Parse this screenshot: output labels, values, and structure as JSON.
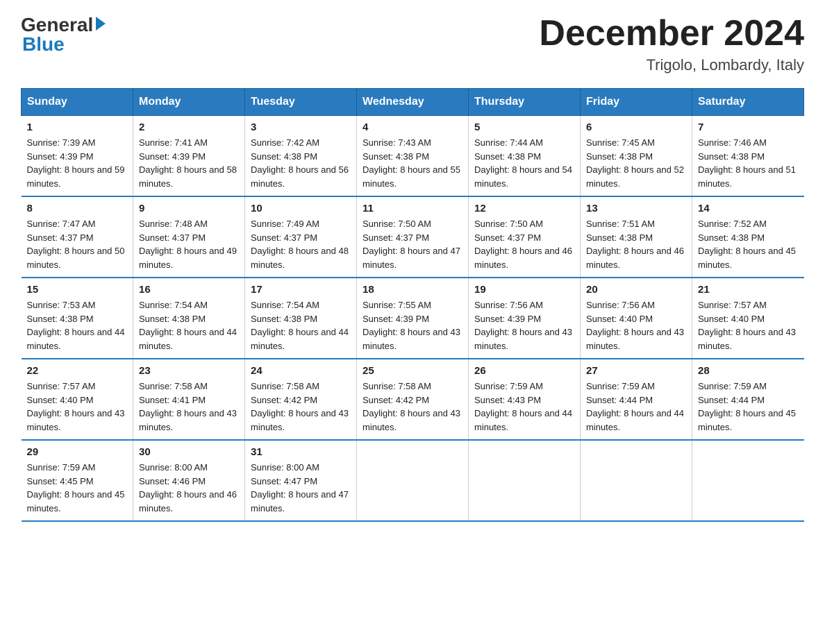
{
  "header": {
    "logo_general": "General",
    "logo_blue": "Blue",
    "month_title": "December 2024",
    "location": "Trigolo, Lombardy, Italy"
  },
  "days_of_week": [
    "Sunday",
    "Monday",
    "Tuesday",
    "Wednesday",
    "Thursday",
    "Friday",
    "Saturday"
  ],
  "weeks": [
    [
      {
        "day": "1",
        "sunrise": "7:39 AM",
        "sunset": "4:39 PM",
        "daylight": "8 hours and 59 minutes."
      },
      {
        "day": "2",
        "sunrise": "7:41 AM",
        "sunset": "4:39 PM",
        "daylight": "8 hours and 58 minutes."
      },
      {
        "day": "3",
        "sunrise": "7:42 AM",
        "sunset": "4:38 PM",
        "daylight": "8 hours and 56 minutes."
      },
      {
        "day": "4",
        "sunrise": "7:43 AM",
        "sunset": "4:38 PM",
        "daylight": "8 hours and 55 minutes."
      },
      {
        "day": "5",
        "sunrise": "7:44 AM",
        "sunset": "4:38 PM",
        "daylight": "8 hours and 54 minutes."
      },
      {
        "day": "6",
        "sunrise": "7:45 AM",
        "sunset": "4:38 PM",
        "daylight": "8 hours and 52 minutes."
      },
      {
        "day": "7",
        "sunrise": "7:46 AM",
        "sunset": "4:38 PM",
        "daylight": "8 hours and 51 minutes."
      }
    ],
    [
      {
        "day": "8",
        "sunrise": "7:47 AM",
        "sunset": "4:37 PM",
        "daylight": "8 hours and 50 minutes."
      },
      {
        "day": "9",
        "sunrise": "7:48 AM",
        "sunset": "4:37 PM",
        "daylight": "8 hours and 49 minutes."
      },
      {
        "day": "10",
        "sunrise": "7:49 AM",
        "sunset": "4:37 PM",
        "daylight": "8 hours and 48 minutes."
      },
      {
        "day": "11",
        "sunrise": "7:50 AM",
        "sunset": "4:37 PM",
        "daylight": "8 hours and 47 minutes."
      },
      {
        "day": "12",
        "sunrise": "7:50 AM",
        "sunset": "4:37 PM",
        "daylight": "8 hours and 46 minutes."
      },
      {
        "day": "13",
        "sunrise": "7:51 AM",
        "sunset": "4:38 PM",
        "daylight": "8 hours and 46 minutes."
      },
      {
        "day": "14",
        "sunrise": "7:52 AM",
        "sunset": "4:38 PM",
        "daylight": "8 hours and 45 minutes."
      }
    ],
    [
      {
        "day": "15",
        "sunrise": "7:53 AM",
        "sunset": "4:38 PM",
        "daylight": "8 hours and 44 minutes."
      },
      {
        "day": "16",
        "sunrise": "7:54 AM",
        "sunset": "4:38 PM",
        "daylight": "8 hours and 44 minutes."
      },
      {
        "day": "17",
        "sunrise": "7:54 AM",
        "sunset": "4:38 PM",
        "daylight": "8 hours and 44 minutes."
      },
      {
        "day": "18",
        "sunrise": "7:55 AM",
        "sunset": "4:39 PM",
        "daylight": "8 hours and 43 minutes."
      },
      {
        "day": "19",
        "sunrise": "7:56 AM",
        "sunset": "4:39 PM",
        "daylight": "8 hours and 43 minutes."
      },
      {
        "day": "20",
        "sunrise": "7:56 AM",
        "sunset": "4:40 PM",
        "daylight": "8 hours and 43 minutes."
      },
      {
        "day": "21",
        "sunrise": "7:57 AM",
        "sunset": "4:40 PM",
        "daylight": "8 hours and 43 minutes."
      }
    ],
    [
      {
        "day": "22",
        "sunrise": "7:57 AM",
        "sunset": "4:40 PM",
        "daylight": "8 hours and 43 minutes."
      },
      {
        "day": "23",
        "sunrise": "7:58 AM",
        "sunset": "4:41 PM",
        "daylight": "8 hours and 43 minutes."
      },
      {
        "day": "24",
        "sunrise": "7:58 AM",
        "sunset": "4:42 PM",
        "daylight": "8 hours and 43 minutes."
      },
      {
        "day": "25",
        "sunrise": "7:58 AM",
        "sunset": "4:42 PM",
        "daylight": "8 hours and 43 minutes."
      },
      {
        "day": "26",
        "sunrise": "7:59 AM",
        "sunset": "4:43 PM",
        "daylight": "8 hours and 44 minutes."
      },
      {
        "day": "27",
        "sunrise": "7:59 AM",
        "sunset": "4:44 PM",
        "daylight": "8 hours and 44 minutes."
      },
      {
        "day": "28",
        "sunrise": "7:59 AM",
        "sunset": "4:44 PM",
        "daylight": "8 hours and 45 minutes."
      }
    ],
    [
      {
        "day": "29",
        "sunrise": "7:59 AM",
        "sunset": "4:45 PM",
        "daylight": "8 hours and 45 minutes."
      },
      {
        "day": "30",
        "sunrise": "8:00 AM",
        "sunset": "4:46 PM",
        "daylight": "8 hours and 46 minutes."
      },
      {
        "day": "31",
        "sunrise": "8:00 AM",
        "sunset": "4:47 PM",
        "daylight": "8 hours and 47 minutes."
      },
      null,
      null,
      null,
      null
    ]
  ]
}
